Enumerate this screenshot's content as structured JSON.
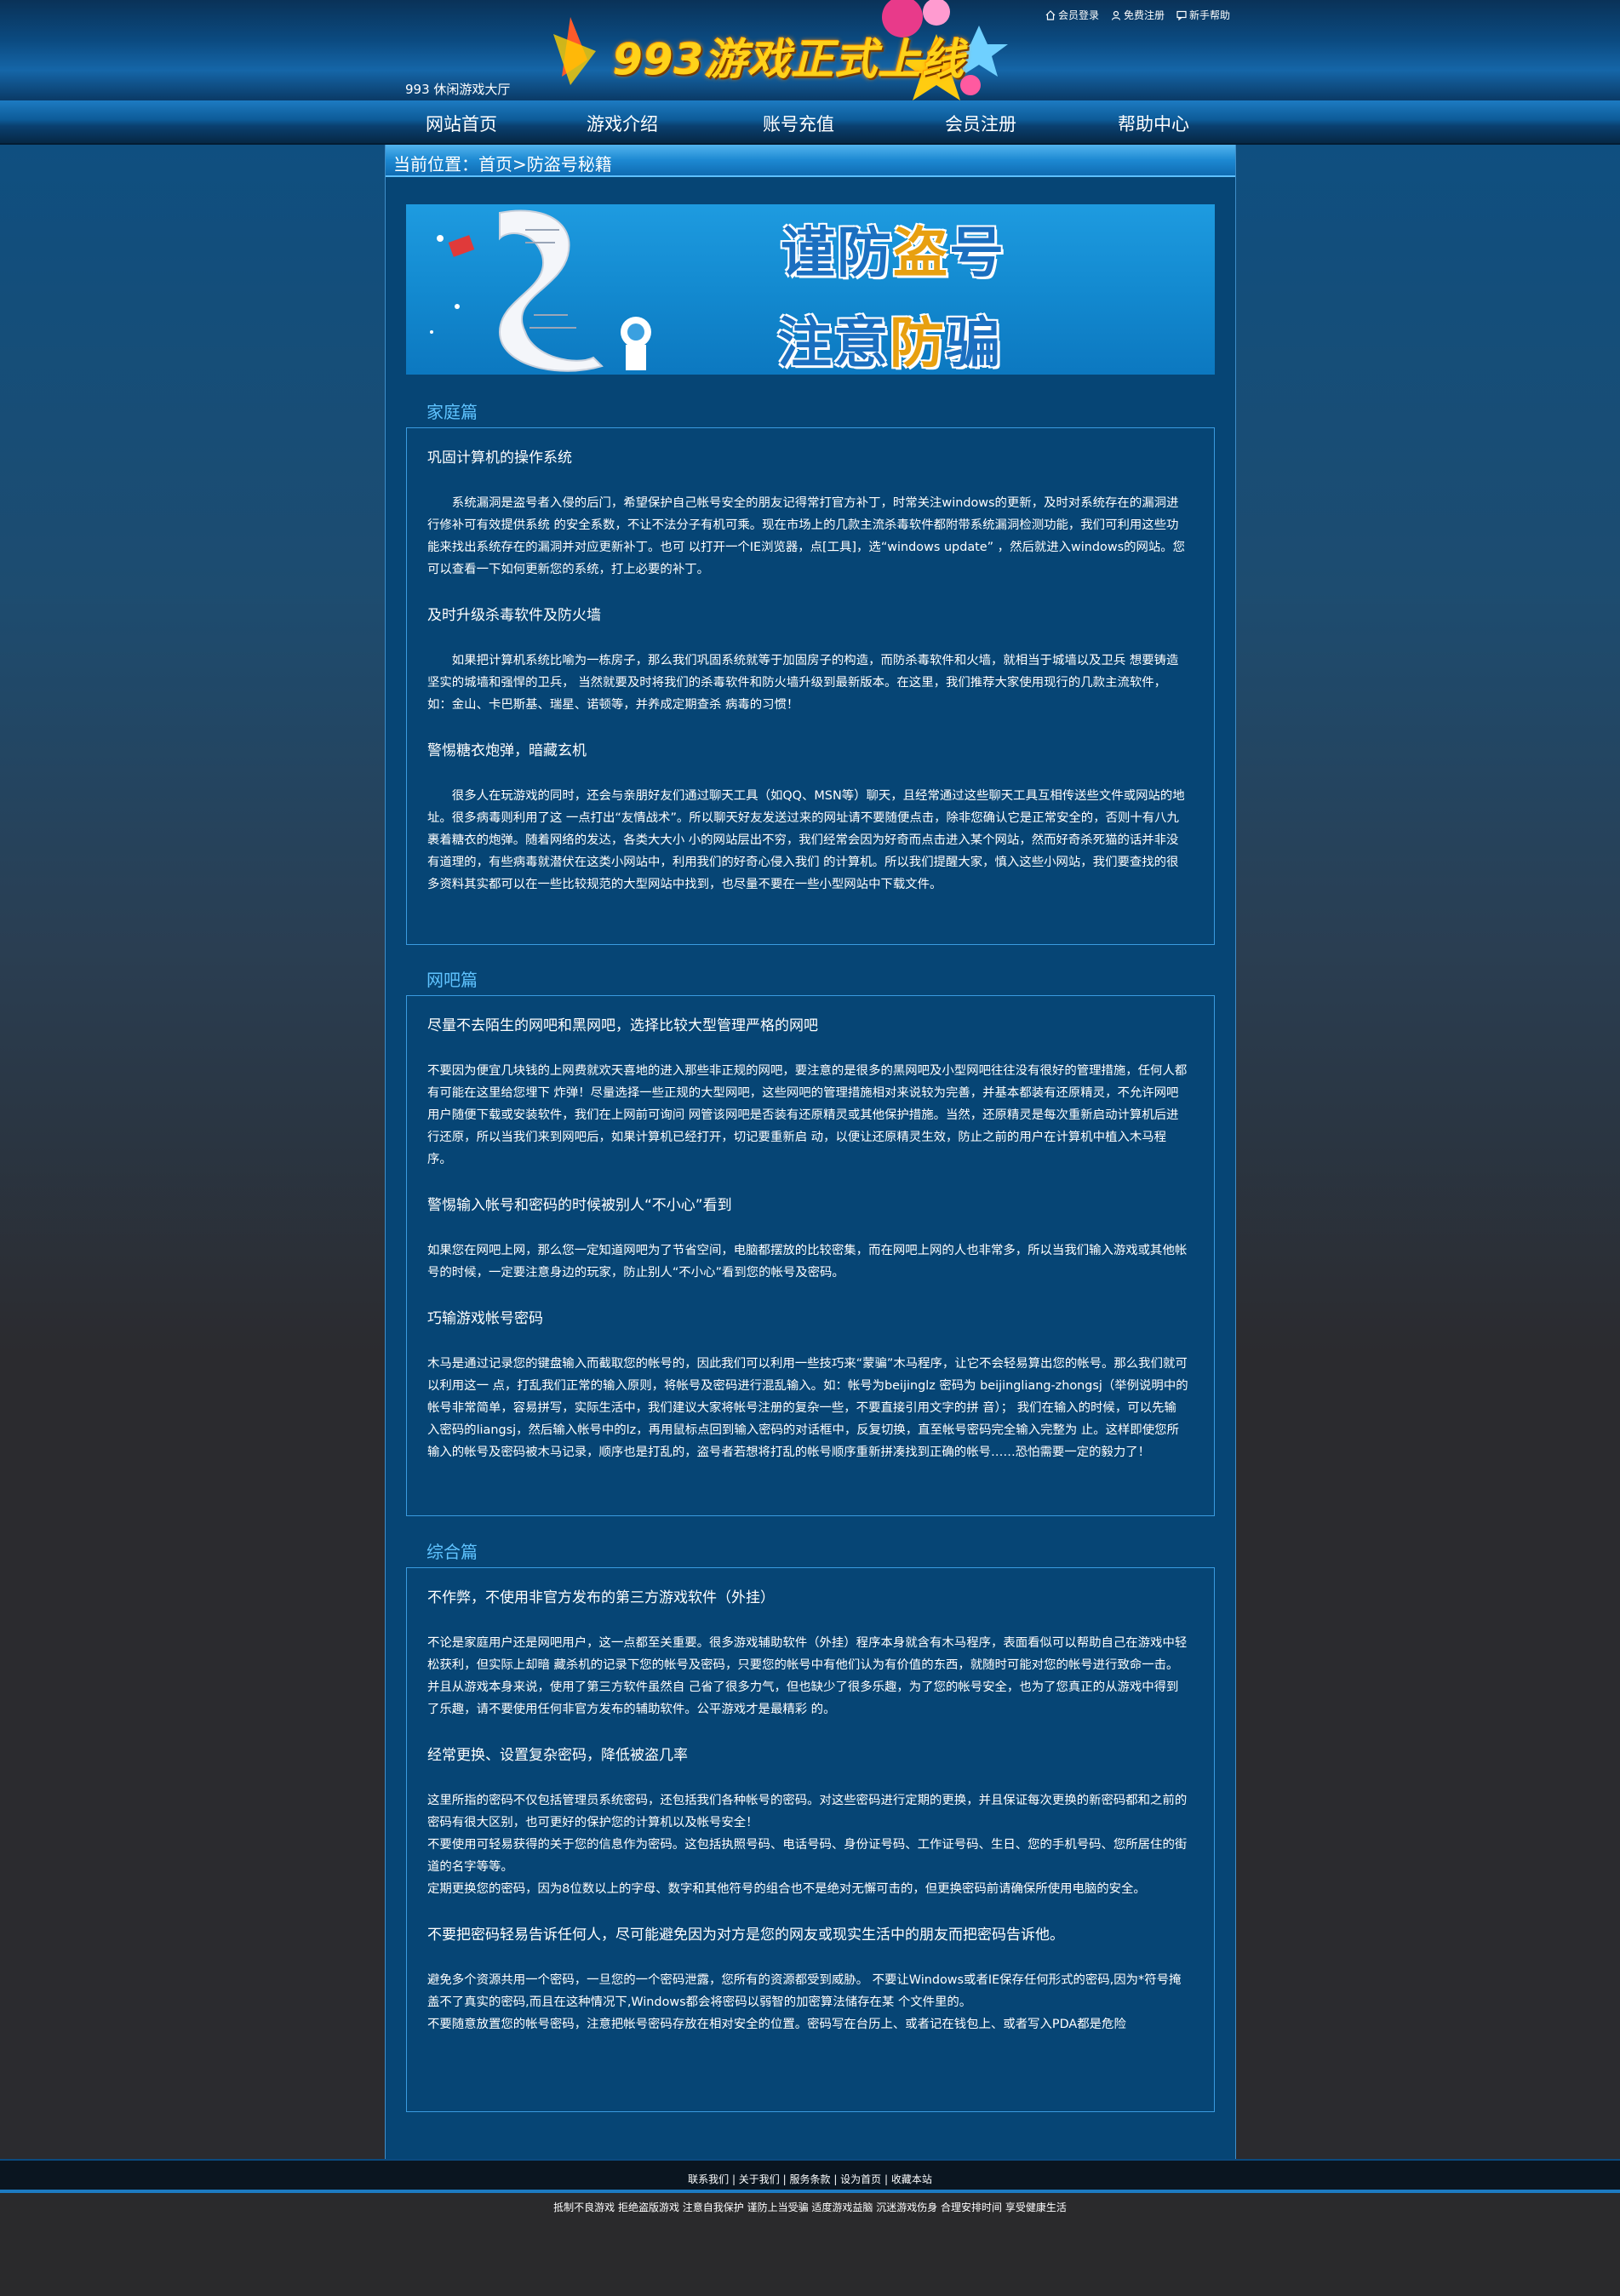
{
  "top_links": [
    "会员登录",
    "免费注册",
    "新手帮助"
  ],
  "brand_sub": "993 休闲游戏大厅",
  "banner_text": "993游戏正式上线",
  "nav": [
    "网站首页",
    "游戏介绍",
    "账号充值",
    "会员注册",
    "帮助中心"
  ],
  "breadcrumb": "当前位置：首页>防盗号秘籍",
  "promo": {
    "line1_a": "谨防",
    "line1_b": "盗",
    "line1_c": "号",
    "line2_a": "注意",
    "line2_b": "防",
    "line2_c": "骗"
  },
  "sections": [
    {
      "title": "家庭篇",
      "items": [
        {
          "h": "巩固计算机的操作系统",
          "p": [
            "系统漏洞是盗号者入侵的后门，希望保护自己帐号安全的朋友记得常打官方补丁，时常关注windows的更新，及时对系统存在的漏洞进行修补可有效提供系统 的安全系数，不让不法分子有机可乘。现在市场上的几款主流杀毒软件都附带系统漏洞检测功能，我们可利用这些功能来找出系统存在的漏洞并对应更新补丁。也可 以打开一个IE浏览器，点[工具]，选“windows update” ，然后就进入windows的网站。您可以查看一下如何更新您的系统，打上必要的补丁。"
          ]
        },
        {
          "h": "及时升级杀毒软件及防火墙",
          "p": [
            "如果把计算机系统比喻为一栋房子，那么我们巩固系统就等于加固房子的构造，而防杀毒软件和火墙，就相当于城墙以及卫兵 想要铸造坚实的城墙和强悍的卫兵， 当然就要及时将我们的杀毒软件和防火墙升级到最新版本。在这里，我们推荐大家使用现行的几款主流软件，如：金山、卡巴斯基、瑞星、诺顿等，并养成定期查杀 病毒的习惯！"
          ]
        },
        {
          "h": "警惕糖衣炮弹，暗藏玄机",
          "p": [
            "很多人在玩游戏的同时，还会与亲朋好友们通过聊天工具（如QQ、MSN等）聊天，且经常通过这些聊天工具互相传送些文件或网站的地址。很多病毒则利用了这 一点打出“友情战术”。所以聊天好友发送过来的网址请不要随便点击，除非您确认它是正常安全的，否则十有八九裹着糖衣的炮弹。随着网络的发达，各类大大小 小的网站层出不穷，我们经常会因为好奇而点击进入某个网站，然而好奇杀死猫的话并非没有道理的，有些病毒就潜伏在这类小网站中，利用我们的好奇心侵入我们 的计算机。所以我们提醒大家，慎入这些小网站，我们要查找的很多资料其实都可以在一些比较规范的大型网站中找到，也尽量不要在一些小型网站中下载文件。"
          ]
        }
      ]
    },
    {
      "title": "网吧篇",
      "items": [
        {
          "h": "尽量不去陌生的网吧和黑网吧，选择比较大型管理严格的网吧",
          "p": [
            "不要因为便宜几块钱的上网费就欢天喜地的进入那些非正规的网吧，要注意的是很多的黑网吧及小型网吧往往没有很好的管理措施，任何人都有可能在这里给您埋下 炸弹！尽量选择一些正规的大型网吧，这些网吧的管理措施相对来说较为完善，并基本都装有还原精灵，不允许网吧用户随便下载或安装软件，我们在上网前可询问 网管该网吧是否装有还原精灵或其他保护措施。当然，还原精灵是每次重新启动计算机后进行还原，所以当我们来到网吧后，如果计算机已经打开，切记要重新启 动，以便让还原精灵生效，防止之前的用户在计算机中植入木马程序。"
          ]
        },
        {
          "h": "警惕输入帐号和密码的时候被别人“不小心”看到",
          "p": [
            "如果您在网吧上网，那么您一定知道网吧为了节省空间，电脑都摆放的比较密集，而在网吧上网的人也非常多，所以当我们输入游戏或其他帐号的时候，一定要注意身边的玩家，防止别人“不小心”看到您的帐号及密码。"
          ]
        },
        {
          "h": "巧输游戏帐号密码",
          "p": [
            " 木马是通过记录您的键盘输入而截取您的帐号的，因此我们可以利用一些技巧来“蒙骗”木马程序，让它不会轻易算出您的帐号。那么我们就可以利用这一 点，打乱我们正常的输入原则，将帐号及密码进行混乱输入。如：帐号为beijinglz 密码为 beijingliang-zhongsj（举例说明中的帐号非常简单，容易拼写，实际生活中，我们建议大家将帐号注册的复杂一些，不要直接引用文字的拼 音）； 我们在输入的时候，可以先输入密码的liangsj，然后输入帐号中的lz，再用鼠标点回到输入密码的对话框中，反复切换，直至帐号密码完全输入完整为 止。这样即使您所输入的帐号及密码被木马记录，顺序也是打乱的，盗号者若想将打乱的帐号顺序重新拼凑找到正确的帐号……恐怕需要一定的毅力了！"
          ]
        }
      ]
    },
    {
      "title": "综合篇",
      "items": [
        {
          "h": "不作弊，不使用非官方发布的第三方游戏软件（外挂）",
          "p": [
            "不论是家庭用户还是网吧用户，这一点都至关重要。很多游戏辅助软件（外挂）程序本身就含有木马程序，表面看似可以帮助自己在游戏中轻松获利，但实际上却暗 藏杀机的记录下您的帐号及密码，只要您的帐号中有他们认为有价值的东西，就随时可能对您的帐号进行致命一击。并且从游戏本身来说，使用了第三方软件虽然自 己省了很多力气，但也缺少了很多乐趣，为了您的帐号安全，也为了您真正的从游戏中得到了乐趣，请不要使用任何非官方发布的辅助软件。公平游戏才是最精彩 的。"
          ]
        },
        {
          "h": "经常更换、设置复杂密码，降低被盗几率",
          "p": [
            "这里所指的密码不仅包括管理员系统密码，还包括我们各种帐号的密码。对这些密码进行定期的更换，并且保证每次更换的新密码都和之前的密码有很大区别，也可更好的保护您的计算机以及帐号安全！",
            "不要使用可轻易获得的关于您的信息作为密码。这包括执照号码、电话号码、身份证号码、工作证号码、生日、您的手机号码、您所居住的街道的名字等等。",
            "定期更换您的密码，因为8位数以上的字母、数字和其他符号的组合也不是绝对无懈可击的，但更换密码前请确保所使用电脑的安全。"
          ]
        },
        {
          "h": "不要把密码轻易告诉任何人，尽可能避免因为对方是您的网友或现实生活中的朋友而把密码告诉他。",
          "p": [
            "避免多个资源共用一个密码，一旦您的一个密码泄露，您所有的资源都受到威胁。 不要让Windows或者IE保存任何形式的密码,因为*符号掩盖不了真实的密码,而且在这种情况下,Windows都会将密码以弱智的加密算法储存在某 个文件里的。",
            "不要随意放置您的帐号密码，注意把帐号密码存放在相对安全的位置。密码写在台历上、或者记在钱包上、或者写入PDA都是危险"
          ]
        }
      ]
    }
  ],
  "footer_links": [
    "联系我们",
    "关于我们",
    "服务条款",
    "设为首页",
    "收藏本站"
  ],
  "footer_notice": "抵制不良游戏 拒绝盗版游戏 注意自我保护 谨防上当受骗 适度游戏益脑 沉迷游戏伤身 合理安排时间 享受健康生活"
}
